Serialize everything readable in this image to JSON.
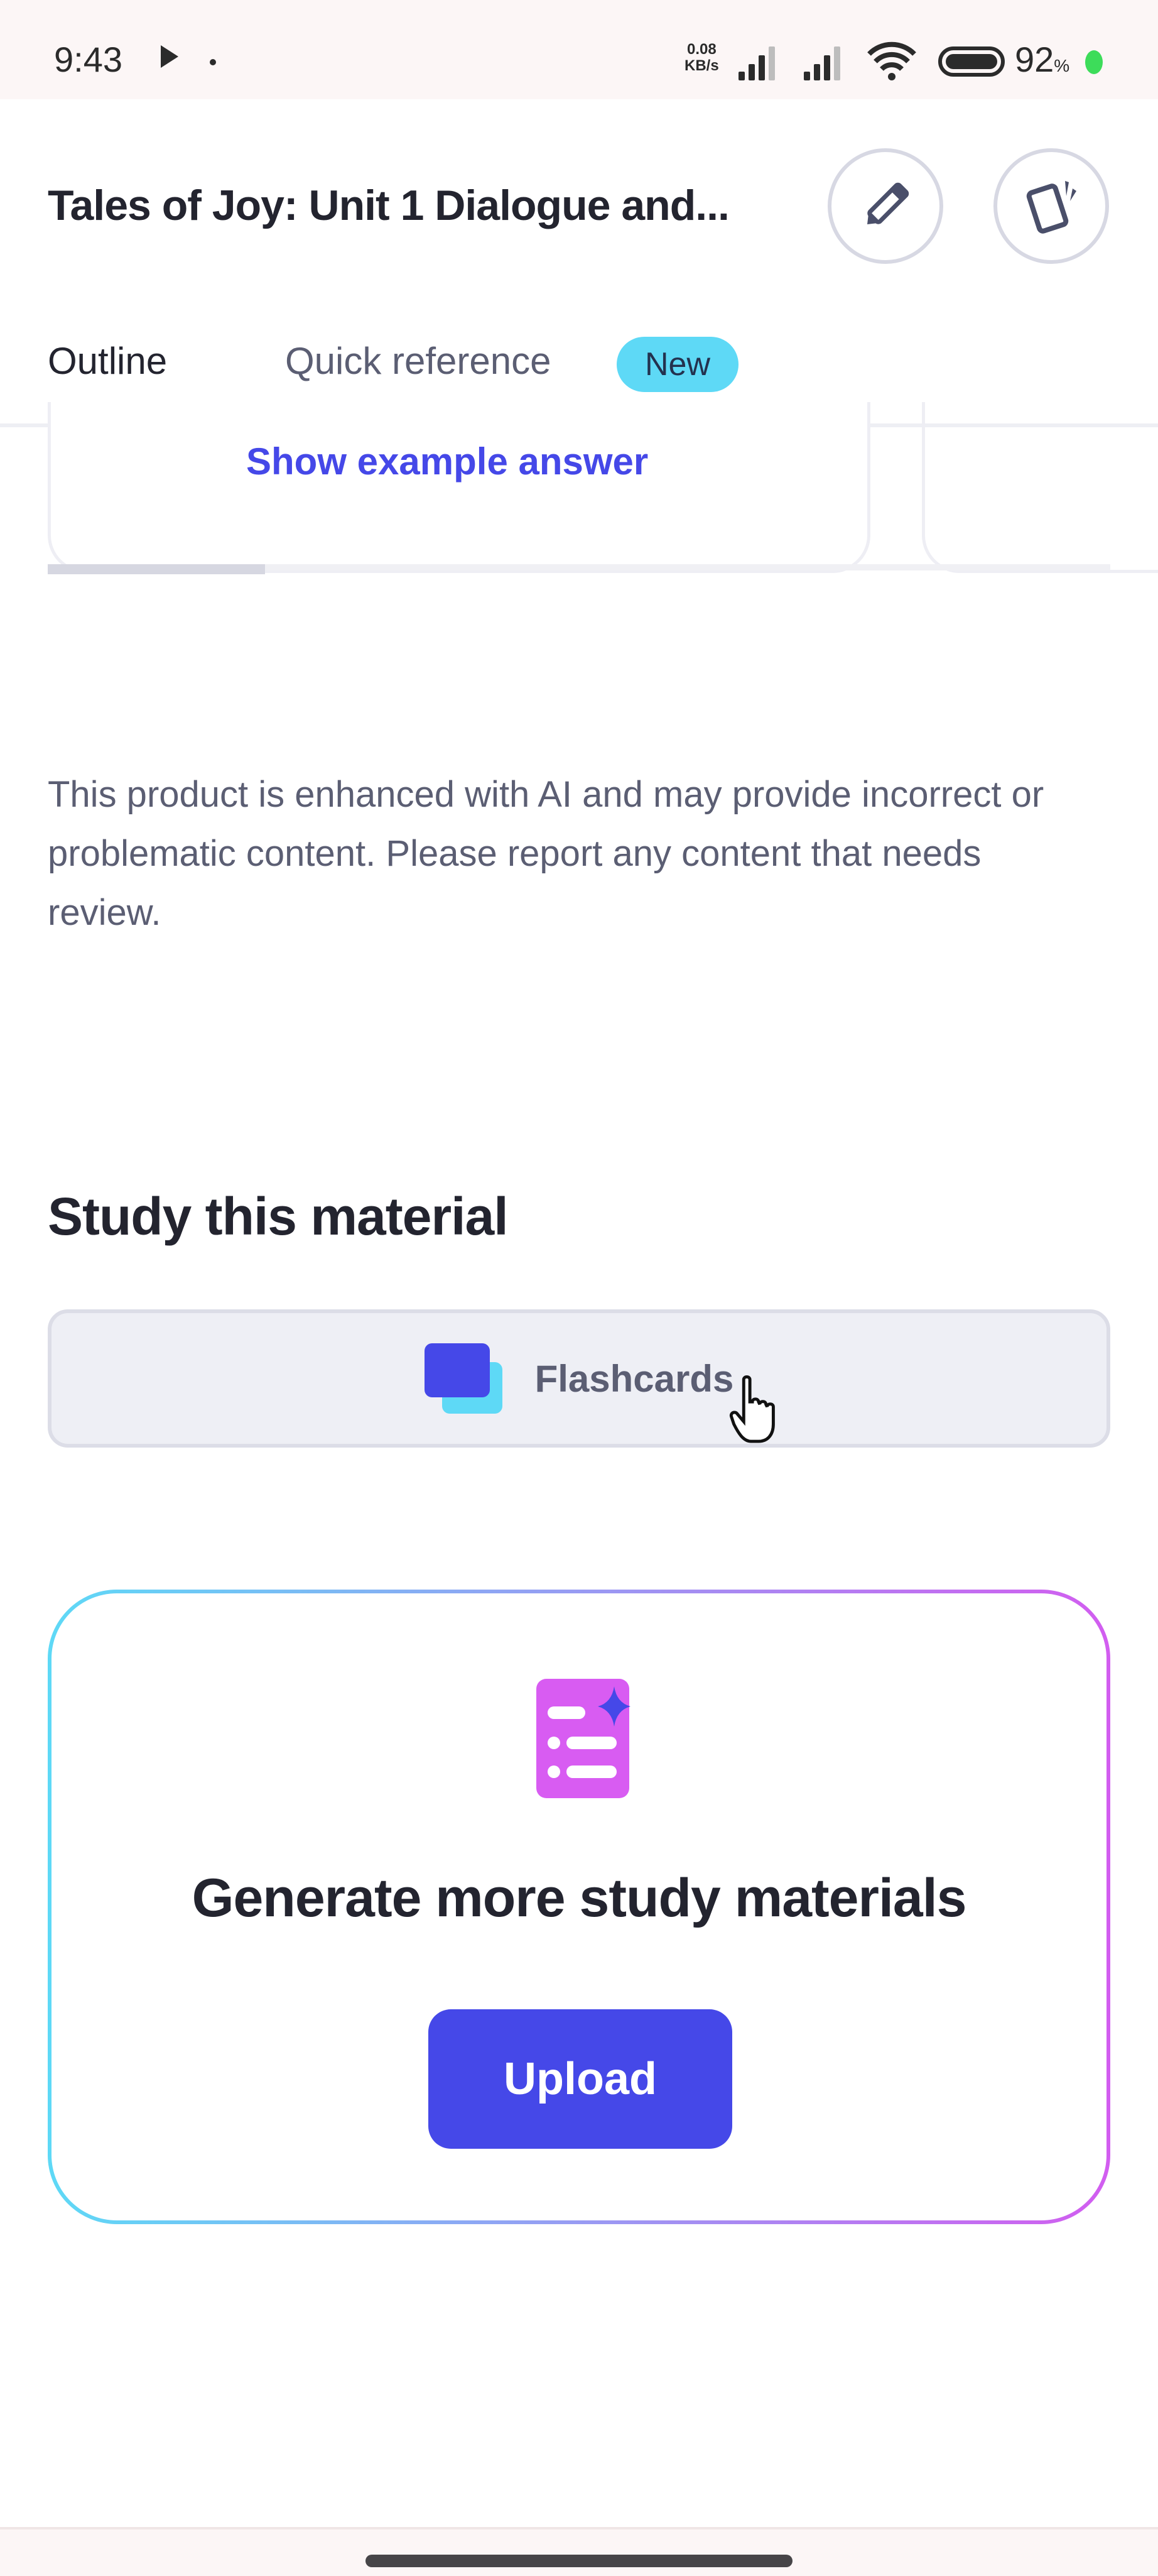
{
  "status_bar": {
    "time": "9:43",
    "net_speed_value": "0.08",
    "net_speed_unit": "KB/s",
    "battery_percent": "92",
    "battery_unit": "%"
  },
  "header": {
    "title": "Tales of Joy: Unit 1 Dialogue and...",
    "edit_icon": "pencil-icon",
    "rotate_icon": "rotate-device-icon"
  },
  "tabs": [
    {
      "label": "Outline",
      "active": true
    },
    {
      "label": "Quick reference",
      "badge": "New",
      "active": false
    }
  ],
  "carousel": {
    "show_example_answer": "Show example answer"
  },
  "disclaimer": "This product is enhanced with AI and may provide incorrect or problematic content. Please report any content that needs review.",
  "study": {
    "heading": "Study this material",
    "flashcards_label": "Flashcards"
  },
  "generate": {
    "title": "Generate more study materials",
    "upload_label": "Upload"
  },
  "colors": {
    "accent": "#4548e8",
    "badge": "#5ed9f6",
    "gradient_start": "#5ed9f6",
    "gradient_end": "#d25df0"
  }
}
